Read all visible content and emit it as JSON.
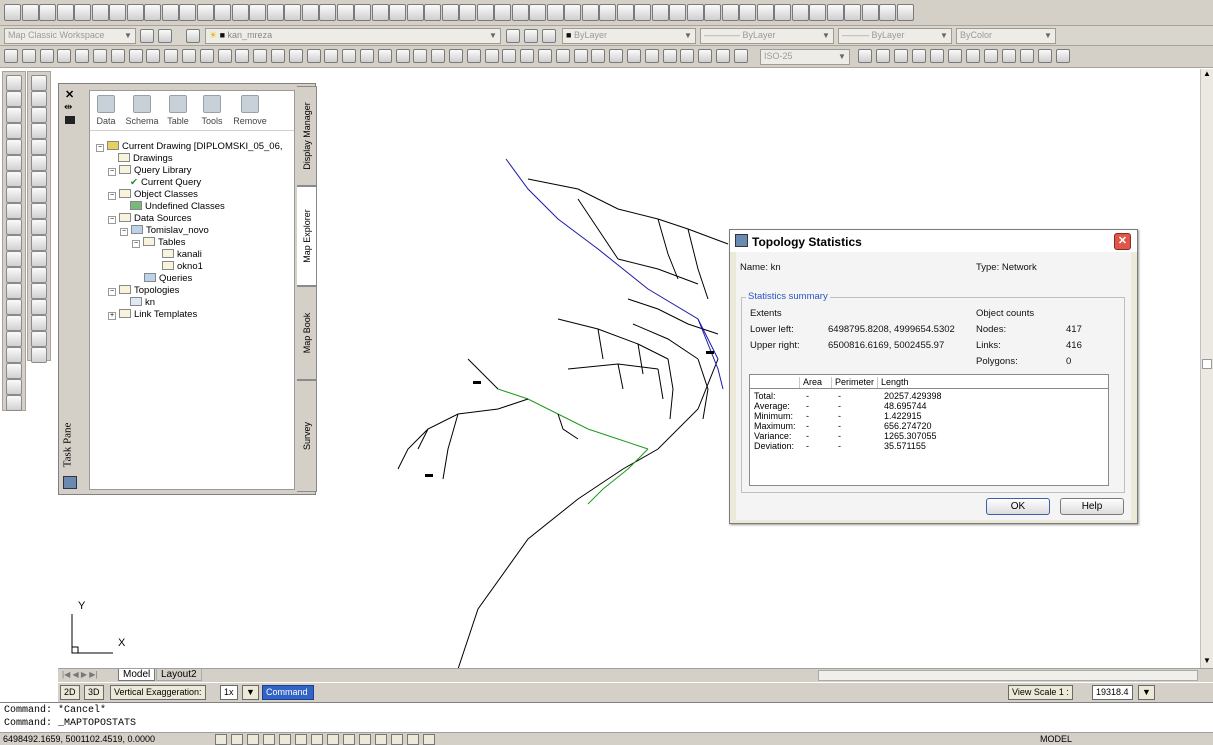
{
  "toolbar2": {
    "workspace": "Map Classic Workspace",
    "layer": "kan_mreza",
    "color": "ByLayer",
    "linetype": "ByLayer",
    "lineweight": "ByLayer",
    "plotstyle": "ByColor"
  },
  "toolbar3": {
    "dimstyle": "ISO-25"
  },
  "task_pane": {
    "title": "Task Pane",
    "toolbar": [
      "Data",
      "Schema",
      "Table",
      "Tools",
      "Remove"
    ],
    "tabs": [
      "Display Manager",
      "Map Explorer",
      "Map Book",
      "Survey"
    ],
    "tree": {
      "root": "Current Drawing [DIPLOMSKI_05_06,",
      "drawings": "Drawings",
      "query_library": "Query Library",
      "current_query": "Current Query",
      "object_classes": "Object Classes",
      "undefined_classes": "Undefined Classes",
      "data_sources": "Data Sources",
      "source": "Tomislav_novo",
      "tables": "Tables",
      "table1": "kanali",
      "table2": "okno1",
      "queries": "Queries",
      "topologies": "Topologies",
      "topology": "kn",
      "link_templates": "Link Templates"
    }
  },
  "dialog": {
    "title": "Topology Statistics",
    "name_label": "Name: kn",
    "type_label": "Type: Network",
    "group_title": "Statistics summary",
    "extents": "Extents",
    "object_counts": "Object counts",
    "lower_left_label": "Lower left:",
    "lower_left": "6498795.8208, 4999654.5302",
    "upper_right_label": "Upper right:",
    "upper_right": "6500816.6169, 5002455.97",
    "nodes_label": "Nodes:",
    "nodes": "417",
    "links_label": "Links:",
    "links": "416",
    "polygons_label": "Polygons:",
    "polygons": "0",
    "columns": [
      "Area",
      "Perimeter",
      "Length"
    ],
    "rows": [
      {
        "label": "Total:",
        "area": "-",
        "perimeter": "-",
        "length": "20257.429398"
      },
      {
        "label": "Average:",
        "area": "-",
        "perimeter": "-",
        "length": "48.695744"
      },
      {
        "label": "Minimum:",
        "area": "-",
        "perimeter": "-",
        "length": "1.422915"
      },
      {
        "label": "Maximum:",
        "area": "-",
        "perimeter": "-",
        "length": "656.274720"
      },
      {
        "label": "Variance:",
        "area": "-",
        "perimeter": "-",
        "length": "1265.307055"
      },
      {
        "label": "Deviation:",
        "area": "-",
        "perimeter": "-",
        "length": "35.571155"
      }
    ],
    "ok": "OK",
    "help": "Help"
  },
  "ucs": {
    "y": "Y",
    "x": "X"
  },
  "layout_tabs": [
    "Model",
    "Layout2"
  ],
  "status_row": {
    "btn_2d": "2D",
    "btn_3d": "3D",
    "vert_exag": "Vertical Exaggeration:",
    "exag_value": "1x",
    "command": "Command",
    "view_scale": "View Scale",
    "scale_prefix": "1 :",
    "scale_value": "19318.4"
  },
  "command_line": {
    "line1": "Command: *Cancel*",
    "line2": "Command: _MAPTOPOSTATS"
  },
  "coords": "6498492.1659, 5001102.4519, 0.0000",
  "space": "MODEL",
  "colors": {
    "accent": "#3264c8",
    "network_blue": "#1a1aa8",
    "network_green": "#1e9a1e"
  }
}
